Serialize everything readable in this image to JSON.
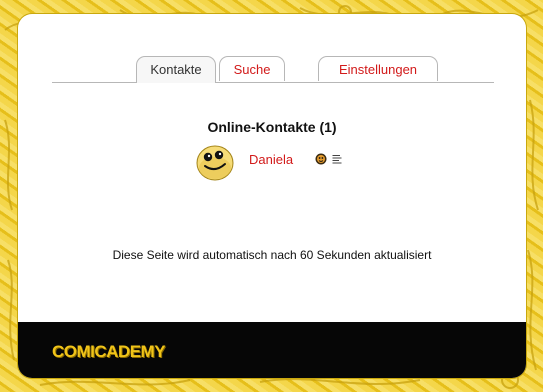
{
  "tabs": [
    {
      "label": "Kontakte",
      "active": true
    },
    {
      "label": "Suche",
      "active": false
    },
    {
      "label": "Einstellungen",
      "active": false
    }
  ],
  "online": {
    "title": "Online-Kontakte (1)",
    "contacts": [
      {
        "name": "Daniela",
        "avatar_icon": "smiley-avatar-icon",
        "status_icon": "user-status-icon",
        "notes_icon": "notes-icon"
      }
    ]
  },
  "refresh_note": "Diese Seite wird automatisch nach 60 Sekunden aktualisiert",
  "footer": {
    "brand": "COMICADEMY"
  },
  "colors": {
    "accent_red": "#d21a1a",
    "background_yellow": "#f1cf2a",
    "footer_bg": "#060606",
    "brand_yellow": "#f0c419"
  }
}
